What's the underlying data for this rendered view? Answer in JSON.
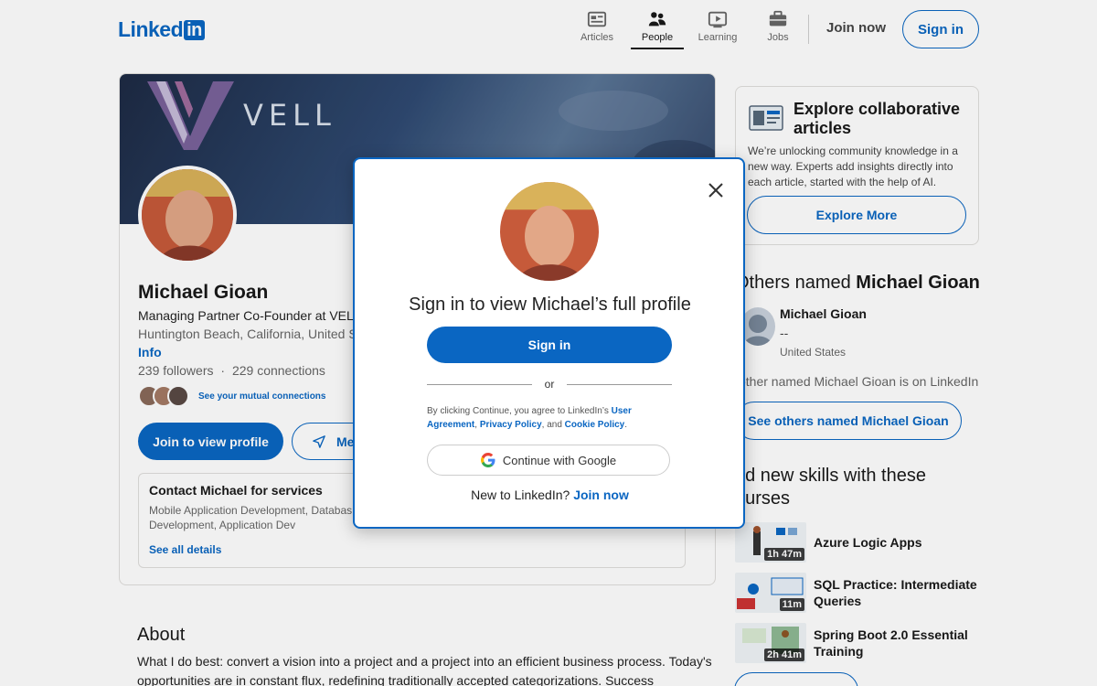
{
  "header": {
    "logo_text": "Linked",
    "logo_in": "in",
    "nav": [
      {
        "label": "Articles",
        "icon": "articles-icon",
        "active": false
      },
      {
        "label": "People",
        "icon": "people-icon",
        "active": true
      },
      {
        "label": "Learning",
        "icon": "learning-icon",
        "active": false
      },
      {
        "label": "Jobs",
        "icon": "jobs-icon",
        "active": false
      }
    ],
    "join_now": "Join now",
    "sign_in": "Sign in"
  },
  "profile": {
    "banner_text": "VELL",
    "name": "Michael Gioan",
    "headline": "Managing Partner Co-Founder at VELL",
    "location": "Huntington Beach, California, United St",
    "info_link": "Info",
    "followers": "239 followers",
    "connections": "229 connections",
    "stats_separator": "·",
    "mutual_link": "See your mutual connections",
    "join_button": "Join to view profile",
    "message_button": "Mes",
    "services": {
      "title": "Contact Michael for services",
      "list": "Mobile Application Development, Databas Application Development, Application Dev",
      "link": "See all details"
    }
  },
  "about": {
    "title": "About",
    "text": "What I do best: convert a vision into a project and a project into an efficient business process. Today's opportunities are in constant flux, redefining traditionally accepted categorizations. Success"
  },
  "sidebar": {
    "explore": {
      "title": "Explore collaborative articles",
      "description": "We’re unlocking community knowledge in a new way. Experts add insights directly into each article, started with the help of AI.",
      "button": "Explore More"
    },
    "others": {
      "title_prefix": "Others named ",
      "title_name": "Michael Gioan",
      "person": {
        "name": "Michael Gioan",
        "headline": "--",
        "location": "United States"
      },
      "count_text": "other named Michael Gioan is on LinkedIn",
      "button": "See others named Michael Gioan"
    },
    "courses": {
      "title": "dd new skills with these ourses",
      "items": [
        {
          "title": "Azure Logic Apps",
          "duration": "1h 47m"
        },
        {
          "title": "SQL Practice: Intermediate Queries",
          "duration": "11m"
        },
        {
          "title": "Spring Boot 2.0 Essential Training",
          "duration": "2h 41m"
        }
      ]
    }
  },
  "modal": {
    "title": "Sign in to view Michael’s full profile",
    "sign_in": "Sign in",
    "or": "or",
    "terms_prefix": "By clicking Continue, you agree to LinkedIn’s ",
    "user_agreement": "User Agreement",
    "comma": ", ",
    "privacy_policy": "Privacy Policy",
    "and": ", and ",
    "cookie_policy": "Cookie Policy",
    "period": ".",
    "google_button": "Continue with Google",
    "new_prefix": "New to LinkedIn? ",
    "join_now": "Join now"
  },
  "colors": {
    "brand": "#0a66c2",
    "text": "#191919",
    "muted": "#666666"
  }
}
